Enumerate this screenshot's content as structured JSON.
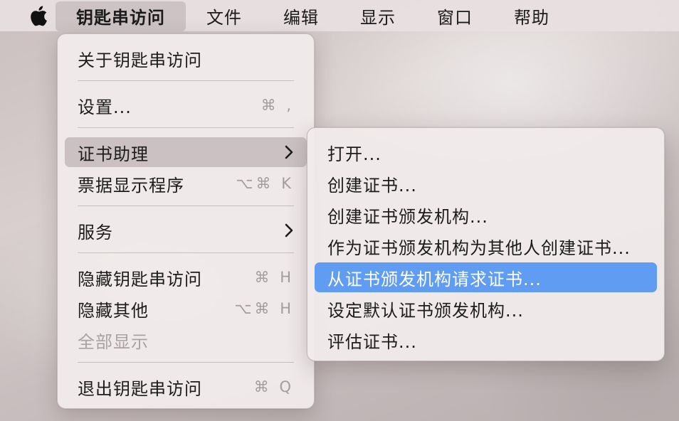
{
  "menubar": {
    "apple_icon": "apple-logo-icon",
    "items": [
      "钥匙串访问",
      "文件",
      "编辑",
      "显示",
      "窗口",
      "帮助"
    ]
  },
  "app_menu": {
    "items": [
      {
        "label": "关于钥匙串访问",
        "shortcut": ""
      },
      {
        "label": "设置...",
        "shortcut": "⌘ ,"
      },
      {
        "label": "证书助理",
        "submenu": true,
        "state": "highlighted"
      },
      {
        "label": "票据显示程序",
        "shortcut": "⌥⌘ K"
      },
      {
        "label": "服务",
        "submenu": true
      },
      {
        "label": "隐藏钥匙串访问",
        "shortcut": "⌘ H"
      },
      {
        "label": "隐藏其他",
        "shortcut": "⌥⌘ H"
      },
      {
        "label": "全部显示",
        "disabled": true
      },
      {
        "label": "退出钥匙串访问",
        "shortcut": "⌘ Q"
      }
    ]
  },
  "cert_assistant_submenu": {
    "items": [
      "打开...",
      "创建证书...",
      "创建证书颁发机构...",
      "作为证书颁发机构为其他人创建证书...",
      "从证书颁发机构请求证书...",
      "设定默认证书颁发机构...",
      "评估证书..."
    ],
    "selected": "从证书颁发机构请求证书..."
  },
  "colors": {
    "selection": "#5f9cf2",
    "hover": "#c4babc",
    "shortcut_text": "#a39d9e"
  }
}
